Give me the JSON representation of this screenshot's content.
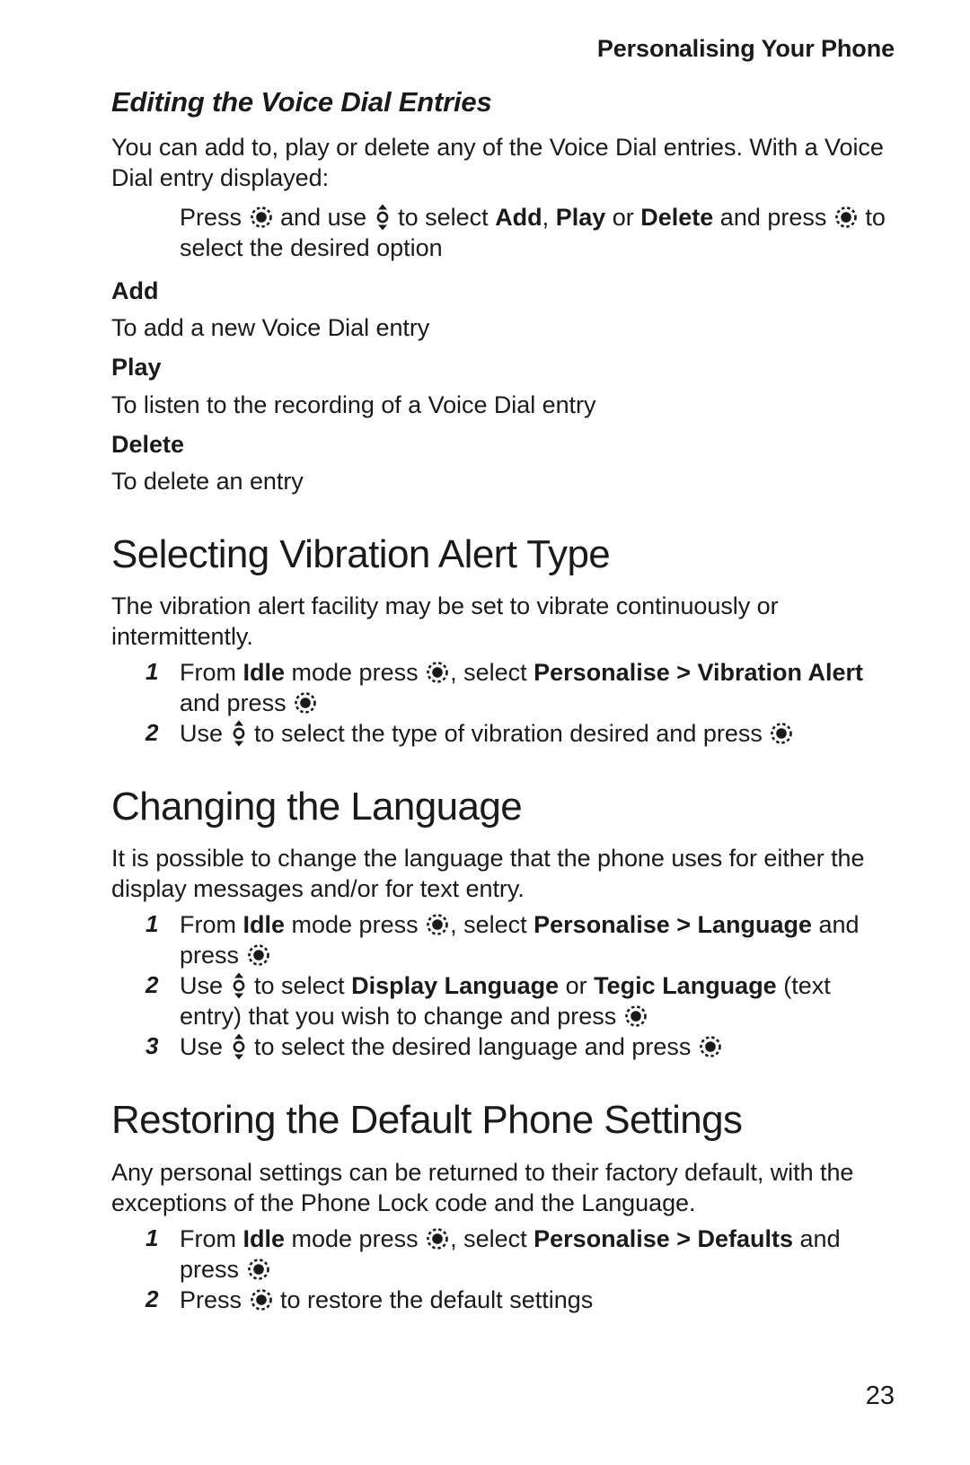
{
  "document": {
    "running_head": "Personalising Your Phone",
    "page_number": "23"
  },
  "icons": {
    "select_key": "select-key-icon",
    "nav_key": "navigation-key-icon"
  },
  "sections": [
    {
      "id": "editing-voice-dial",
      "heading": "Editing the Voice Dial Entries",
      "heading_style": "italic-bold-subhead",
      "intro": "You can add to, play or delete any of the Voice Dial entries. With a Voice Dial entry displayed:",
      "indented_instruction": {
        "part1": "Press ",
        "part2": " and use ",
        "part3": " to select ",
        "bold1": "Add",
        "sep1": ", ",
        "bold2": "Play",
        "sep2": " or ",
        "bold3": "Delete",
        "part4": " and press ",
        "part5": " to select the desired option"
      },
      "definitions": [
        {
          "term": "Add",
          "description": "To add a new Voice Dial entry"
        },
        {
          "term": "Play",
          "description": "To listen to the recording of a Voice Dial entry"
        },
        {
          "term": "Delete",
          "description": "To delete an entry"
        }
      ]
    },
    {
      "id": "selecting-vibration-alert-type",
      "heading": "Selecting Vibration Alert Type",
      "heading_style": "chapter-title",
      "intro": "The vibration alert facility may be set to vibrate continuously or intermittently.",
      "steps": [
        {
          "num": "1",
          "frag": [
            "From ",
            "Idle",
            " mode press ",
            ", select ",
            "Personalise > Vibration Alert",
            " and press ",
            ""
          ]
        },
        {
          "num": "2",
          "frag": [
            "Use ",
            " to select the type of vibration desired and press ",
            ""
          ]
        }
      ]
    },
    {
      "id": "changing-the-language",
      "heading": "Changing the Language",
      "heading_style": "chapter-title",
      "intro": "It is possible to change the language that the phone uses for either the display messages and/or for text entry.",
      "steps": [
        {
          "num": "1",
          "frag": [
            "From ",
            "Idle",
            " mode press ",
            ", select ",
            "Personalise > Language",
            " and press "
          ]
        },
        {
          "num": "2",
          "frag": [
            "Use ",
            " to select ",
            "Display Language",
            " or ",
            "Tegic Language",
            " (text entry) that you wish to change and press "
          ]
        },
        {
          "num": "3",
          "frag": [
            "Use ",
            " to select the desired language and press "
          ]
        }
      ]
    },
    {
      "id": "restoring-default-phone-settings",
      "heading": "Restoring the Default Phone Settings",
      "heading_style": "chapter-title",
      "intro": "Any personal settings can be returned to their factory default, with the exceptions of the Phone Lock code and the Language.",
      "steps": [
        {
          "num": "1",
          "frag": [
            "From ",
            "Idle",
            " mode press ",
            ", select ",
            "Personalise > Defaults",
            " and press "
          ]
        },
        {
          "num": "2",
          "frag": [
            "Press ",
            " to restore the default settings"
          ]
        }
      ]
    }
  ],
  "text": {
    "running_head": "Personalising Your Phone",
    "page_number": "23",
    "s1_heading": "Editing the Voice Dial Entries",
    "s1_intro": "You can add to, play or delete any of the Voice Dial entries. With a Voice Dial entry displayed:",
    "s1_press": "Press ",
    "s1_anduse": " and use ",
    "s1_toselect": " to select ",
    "s1_add": "Add",
    "s1_comma": ", ",
    "s1_play": "Play",
    "s1_or": " or ",
    "s1_delete": "Delete",
    "s1_andpress": " and press ",
    "s1_tosel_option": " to select the desired option",
    "def1_term": "Add",
    "def1_desc": "To add a new Voice Dial entry",
    "def2_term": "Play",
    "def2_desc": "To listen to the recording of a Voice Dial entry",
    "def3_term": "Delete",
    "def3_desc": "To delete an entry",
    "s2_heading": "Selecting Vibration Alert Type",
    "s2_intro": "The vibration alert facility may be set to vibrate continuously or intermittently.",
    "s2_n1": "1",
    "s2_1a": "From ",
    "s2_1b": "Idle",
    "s2_1c": " mode press ",
    "s2_1d": ", select ",
    "s2_1e": "Personalise > Vibration Alert",
    "s2_1f": " and press ",
    "s2_n2": "2",
    "s2_2a": "Use ",
    "s2_2b": " to select the type of vibration desired and press ",
    "s3_heading": "Changing the Language",
    "s3_intro": "It is possible to change the language that the phone uses for either the display messages and/or for text entry.",
    "s3_n1": "1",
    "s3_1a": "From ",
    "s3_1b": "Idle",
    "s3_1c": " mode press ",
    "s3_1d": ", select ",
    "s3_1e": "Personalise > Language",
    "s3_1f": " and press ",
    "s3_n2": "2",
    "s3_2a": "Use ",
    "s3_2b": " to select ",
    "s3_2c": "Display Language",
    "s3_2d": " or ",
    "s3_2e": "Tegic Language",
    "s3_2f": " (text entry) that you wish to change and press ",
    "s3_n3": "3",
    "s3_3a": "Use ",
    "s3_3b": " to select the desired language and press ",
    "s4_heading": "Restoring the Default Phone Settings",
    "s4_intro": "Any personal settings can be returned to their factory default, with the exceptions of the Phone Lock code and the Language.",
    "s4_n1": "1",
    "s4_1a": "From ",
    "s4_1b": "Idle",
    "s4_1c": " mode press ",
    "s4_1d": ", select ",
    "s4_1e": "Personalise > Defaults",
    "s4_1f": " and press ",
    "s4_n2": "2",
    "s4_2a": "Press ",
    "s4_2b": " to restore the default settings"
  },
  "colors": {
    "text": "#1a1a1a",
    "background": "#ffffff"
  }
}
